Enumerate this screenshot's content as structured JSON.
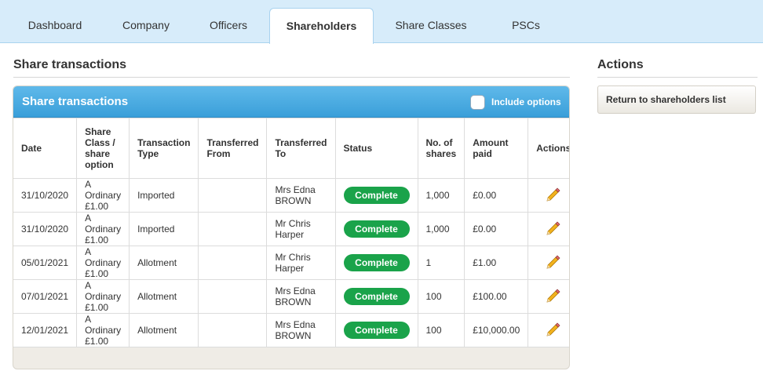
{
  "tabs": [
    {
      "label": "Dashboard",
      "active": false
    },
    {
      "label": "Company",
      "active": false
    },
    {
      "label": "Officers",
      "active": false
    },
    {
      "label": "Shareholders",
      "active": true
    },
    {
      "label": "Share Classes",
      "active": false
    },
    {
      "label": "PSCs",
      "active": false
    }
  ],
  "main": {
    "section_title": "Share transactions",
    "panel_title": "Share transactions",
    "include_options_label": "Include options",
    "include_options_checked": false,
    "columns": [
      [
        "Date"
      ],
      [
        "Share",
        "Class /",
        "share",
        "option"
      ],
      [
        "Transaction",
        "Type"
      ],
      [
        "Transferred",
        "From"
      ],
      [
        "Transferred",
        "To"
      ],
      [
        "Status"
      ],
      [
        "No. of",
        "shares"
      ],
      [
        "Amount",
        "paid"
      ],
      [
        "Actions"
      ]
    ],
    "rows": [
      {
        "date": "31/10/2020",
        "share_class": [
          "A Ordinary",
          "£1.00"
        ],
        "type": "Imported",
        "from": "",
        "to": [
          "Mrs Edna",
          "BROWN"
        ],
        "status": "Complete",
        "shares": "1,000",
        "amount": "£0.00",
        "action_icon": "pencil-icon"
      },
      {
        "date": "31/10/2020",
        "share_class": [
          "A Ordinary",
          "£1.00"
        ],
        "type": "Imported",
        "from": "",
        "to": [
          "Mr Chris",
          "Harper"
        ],
        "status": "Complete",
        "shares": "1,000",
        "amount": "£0.00",
        "action_icon": "pencil-icon"
      },
      {
        "date": "05/01/2021",
        "share_class": [
          "A Ordinary",
          "£1.00"
        ],
        "type": "Allotment",
        "from": "",
        "to": [
          "Mr Chris",
          "Harper"
        ],
        "status": "Complete",
        "shares": "1",
        "amount": "£1.00",
        "action_icon": "pencil-icon"
      },
      {
        "date": "07/01/2021",
        "share_class": [
          "A Ordinary",
          "£1.00"
        ],
        "type": "Allotment",
        "from": "",
        "to": [
          "Mrs Edna",
          "BROWN"
        ],
        "status": "Complete",
        "shares": "100",
        "amount": "£100.00",
        "action_icon": "pencil-icon"
      },
      {
        "date": "12/01/2021",
        "share_class": [
          "A Ordinary",
          "£1.00"
        ],
        "type": "Allotment",
        "from": "",
        "to": [
          "Mrs Edna",
          "BROWN"
        ],
        "status": "Complete",
        "shares": "100",
        "amount": "£10,000.00",
        "action_icon": "pencil-icon"
      }
    ]
  },
  "sidebar": {
    "title": "Actions",
    "return_button_label": "Return to shareholders list"
  },
  "colors": {
    "tabbar_bg": "#d7ecfa",
    "panel_header": "#3a9fd9",
    "status_complete": "#1aa34a",
    "panel_bg": "#efece6"
  }
}
